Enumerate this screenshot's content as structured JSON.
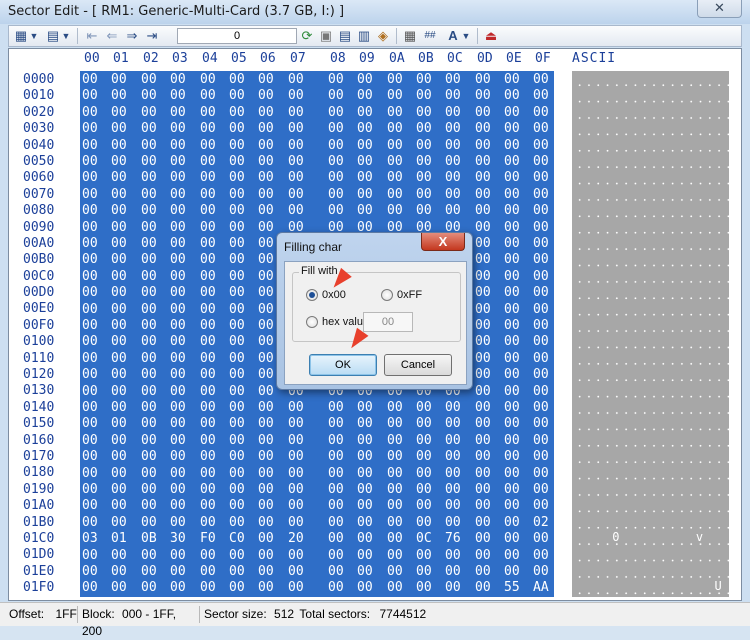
{
  "window": {
    "title": "Sector Edit - [ RM1: Generic-Multi-Card (3.7 GB, I:) ]",
    "close_label": "✕"
  },
  "toolbar": {
    "sector_value": "0",
    "icons": [
      "grid-view-icon",
      "dropdown-icon",
      "list-view-icon",
      "dropdown-icon",
      "first-sector-icon",
      "prev-sector-icon",
      "next-sector-icon",
      "last-sector-icon",
      "refresh-icon",
      "save-icon",
      "save-file-icon",
      "load-file-icon",
      "fill-icon",
      "calculator-icon",
      "checksum-icon",
      "font-icon",
      "dropdown-icon",
      "exit-icon"
    ]
  },
  "editor": {
    "hex_headers": [
      "00",
      "01",
      "02",
      "03",
      "04",
      "05",
      "06",
      "07",
      "08",
      "09",
      "0A",
      "0B",
      "0C",
      "0D",
      "0E",
      "0F"
    ],
    "ascii_label": "ASCII",
    "offsets": [
      "0000",
      "0010",
      "0020",
      "0030",
      "0040",
      "0050",
      "0060",
      "0070",
      "0080",
      "0090",
      "00A0",
      "00B0",
      "00C0",
      "00D0",
      "00E0",
      "00F0",
      "0100",
      "0110",
      "0120",
      "0130",
      "0140",
      "0150",
      "0160",
      "0170",
      "0180",
      "0190",
      "01A0",
      "01B0",
      "01C0",
      "01D0",
      "01E0",
      "01F0"
    ],
    "special_rows": {
      "27": [
        "00",
        "00",
        "00",
        "00",
        "00",
        "00",
        "00",
        "00",
        "00",
        "00",
        "00",
        "00",
        "00",
        "00",
        "00",
        "02"
      ],
      "28": [
        "03",
        "01",
        "0B",
        "30",
        "F0",
        "C0",
        "00",
        "20",
        "00",
        "00",
        "00",
        "0C",
        "76",
        "00",
        "00",
        "00"
      ],
      "31": [
        "00",
        "00",
        "00",
        "00",
        "00",
        "00",
        "00",
        "00",
        "00",
        "00",
        "00",
        "00",
        "00",
        "00",
        "55",
        "AA"
      ]
    },
    "ascii_chars": [
      {
        "row": 28,
        "col": 4,
        "char": "0"
      },
      {
        "row": 28,
        "col": 13,
        "char": "v"
      },
      {
        "row": 31,
        "col": 15,
        "char": "U"
      }
    ]
  },
  "status": {
    "offset_label": "Offset:",
    "offset_value": "1FF",
    "block_label": "Block:",
    "block_value": "000 - 1FF, 200",
    "sector_size_label": "Sector size:",
    "sector_size_value": "512",
    "total_sectors_label": "Total sectors:",
    "total_sectors_value": "7744512"
  },
  "dialog": {
    "title": "Filling char",
    "close_label": "X",
    "group_label": "Fill with",
    "option_0x00": "0x00",
    "option_0xff": "0xFF",
    "option_hex": "hex value:",
    "hex_value": "00",
    "selected": "0x00",
    "ok_label": "OK",
    "cancel_label": "Cancel"
  },
  "colors": {
    "selection": "#2f6ec7",
    "header_text": "#1b3f99",
    "annotation_arrow": "#e8402c"
  }
}
